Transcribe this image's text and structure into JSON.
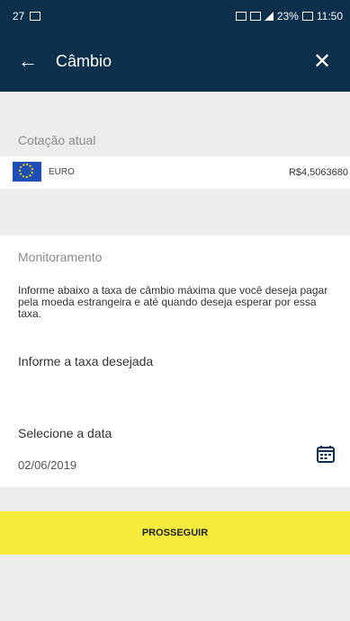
{
  "status": {
    "left_time": "27",
    "battery": "23%",
    "time": "11:50"
  },
  "header": {
    "back_icon": "back-arrow-icon",
    "title": "Câmbio",
    "close_icon": "close-icon"
  },
  "quote": {
    "label": "Cotação atual",
    "currency": "EURO",
    "rate": "R$4,5063680"
  },
  "monitor": {
    "label": "Monitoramento",
    "description": "Informe abaixo a taxa de câmbio máxima que você deseja pagar pela moeda estrangeira e até quando deseja esperar por essa taxa.",
    "rate_input_label": "Informe a taxa desejada"
  },
  "date": {
    "label": "Selecione a data",
    "value": "02/06/2019"
  },
  "action": {
    "proceed_label": "PROSSEGUIR"
  },
  "colors": {
    "header_bg": "#0c2f4c",
    "proceed_bg": "#f6ec3b"
  }
}
